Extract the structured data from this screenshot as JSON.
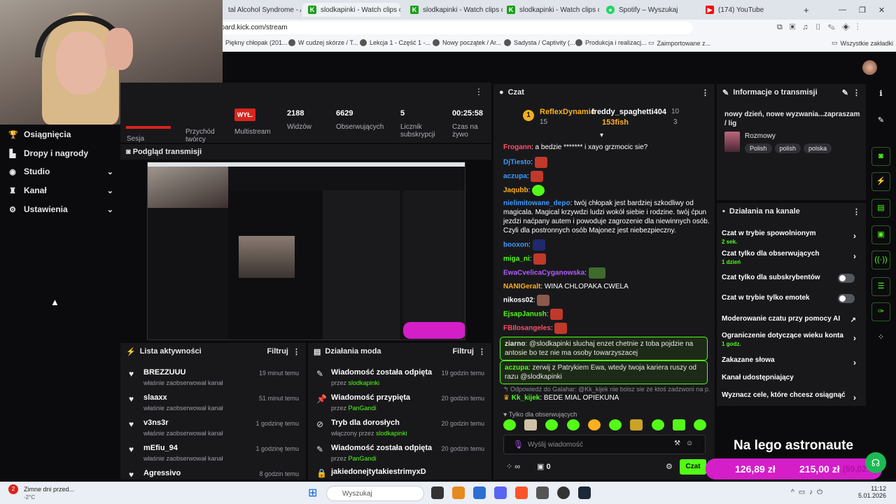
{
  "browser": {
    "tabs": [
      {
        "label": "tal Alcohol Syndrome - Albu",
        "color": "#6b6b6b",
        "glyph": ""
      },
      {
        "label": "slodkapinki - Watch clips on K",
        "color": "#1aa01a",
        "glyph": "K"
      },
      {
        "label": "slodkapinki - Watch clips on K",
        "color": "#1aa01a",
        "glyph": "K"
      },
      {
        "label": "slodkapinki - Watch clips on K",
        "color": "#1aa01a",
        "glyph": "K"
      },
      {
        "label": "Spotify – Wyszukaj",
        "color": "#1ed760",
        "glyph": "●"
      },
      {
        "label": "(174) YouTube",
        "color": "#ff0000",
        "glyph": "▶"
      }
    ],
    "new_tab": "+",
    "url": "board.kick.com/stream",
    "bookmarks": [
      "Piękny chłopak (201...",
      "W cudzej skórze / T...",
      "Lekcja 1 - Część 1 -...",
      "Nowy początek / Ar...",
      "Sadysta / Captivity (...",
      "Produkcja i realizacj...",
      "Zaimportowane z..."
    ],
    "all_bookmarks": "Wszystkie zakładki"
  },
  "nav": {
    "items": [
      {
        "label": "Osiągnięcia",
        "icon": "trophy-icon",
        "glyph": "🏆",
        "chevron": false
      },
      {
        "label": "Dropy i nagrody",
        "icon": "gift-icon",
        "glyph": "▙",
        "chevron": false
      },
      {
        "label": "Studio",
        "icon": "studio-icon",
        "glyph": "◉",
        "chevron": true
      },
      {
        "label": "Kanał",
        "icon": "channel-icon",
        "glyph": "♜",
        "chevron": true
      },
      {
        "label": "Ustawienia",
        "icon": "gear-icon",
        "glyph": "⚙",
        "chevron": true
      }
    ]
  },
  "stats": {
    "session": "Sesja",
    "income": "Przychód twórcy",
    "badge": "WYŁ.",
    "multistream": "Multistream",
    "viewers_value": "2188",
    "viewers_label": "Widzów",
    "followers_value": "6629",
    "followers_label": "Obserwujących",
    "subs_value": "5",
    "subs_label": "Licznik subskrypcji",
    "live_value": "00:25:58",
    "live_label": "Czas na żywo"
  },
  "preview": {
    "title": "Podgląd transmisji"
  },
  "activity": {
    "title": "Lista aktywności",
    "filter": "Filtruj",
    "items": [
      {
        "name": "BREZZUUU",
        "sub": "właśnie zaobserwował kanał",
        "time": "19 minut temu"
      },
      {
        "name": "slaaxx",
        "sub": "właśnie zaobserwował kanał",
        "time": "51 minut temu"
      },
      {
        "name": "v3ns3r",
        "sub": "właśnie zaobserwował kanał",
        "time": "1 godzinę temu"
      },
      {
        "name": "mEfiu_94",
        "sub": "właśnie zaobserwował kanał",
        "time": "1 godzinę temu"
      },
      {
        "name": "Agressivo",
        "sub": "",
        "time": "8 godzin temu"
      }
    ]
  },
  "modactions": {
    "title": "Działania moda",
    "filter": "Filtruj",
    "items": [
      {
        "title": "Wiadomość została odpięta",
        "by": "przez",
        "who": "slodkapinki",
        "time": "19 godzin temu",
        "icon": "pin-off-icon",
        "glyph": "✎"
      },
      {
        "title": "Wiadomość przypięta",
        "by": "przez",
        "who": "PanGandi",
        "time": "20 godzin temu",
        "icon": "pin-icon",
        "glyph": "📌"
      },
      {
        "title": "Tryb dla dorosłych",
        "by": "włączony przez",
        "who": "slodkapinki",
        "time": "20 godzin temu",
        "icon": "eye-off-icon",
        "glyph": "⊘"
      },
      {
        "title": "Wiadomość została odpięta",
        "by": "przez",
        "who": "PanGandi",
        "time": "20 godzin temu",
        "icon": "pin-off-icon",
        "glyph": "✎"
      },
      {
        "title": "jakiedonejtytakiestrimyxD",
        "by": "",
        "who": "",
        "time": "",
        "icon": "lock-icon",
        "glyph": "🔒"
      }
    ]
  },
  "chat": {
    "title": "Czat",
    "pinned": [
      {
        "name": "ReflexDynamic",
        "count": "15"
      },
      {
        "name": "freddy_spaghetti404",
        "count": "10"
      },
      {
        "name": "153fish",
        "count": "3"
      }
    ],
    "rank": "1",
    "messages": [
      {
        "user": "Frogann",
        "color": "#ff4f6a",
        "text": ": a bedzie ******* i xayo grzmocic sie?"
      },
      {
        "user": "DjTiesto",
        "color": "#3d9bff",
        "text": ":"
      },
      {
        "user": "aczupa",
        "color": "#3d9bff",
        "text": ":"
      },
      {
        "user": "Jaqubb",
        "color": "#ffb020",
        "text": ":"
      },
      {
        "user": "nielimitowane_depo",
        "color": "#3d9bff",
        "text": ": twój chłopak jest bardziej szkodliwy od magicala. Magical krzywdzi ludzi wokół siebie i rodzine. twój ćpun jezdzi naćpany autem i powoduje zagrozenie dla niewinnych osób. Czyli dla postronnych osób Majonez jest niebezpieczny."
      },
      {
        "user": "booxon",
        "color": "#3d9bff",
        "text": ":"
      },
      {
        "user": "miga_ni",
        "color": "#53fc18",
        "text": ":"
      },
      {
        "user": "EwaCvelicaCyganowska",
        "color": "#b35cff",
        "text": ":"
      },
      {
        "user": "NANIGeralt",
        "color": "#ffb020",
        "text": ": WINA CHLOPAKA CWELA"
      },
      {
        "user": "nikoss02",
        "color": "#ffffff",
        "text": ":"
      },
      {
        "user": "EjsapJanush",
        "color": "#53fc18",
        "text": ":"
      },
      {
        "user": "FBIlosangeles",
        "color": "#ff4f6a",
        "text": ":"
      }
    ],
    "highlight1_user": "ziarno",
    "highlight1_text": ": @slodkapinki sluchaj enzet chetnie z toba pojdzie na antosie bo tez nie ma osoby towarzyszacej",
    "highlight2_user": "aczupa",
    "highlight2_text": ": zerwij z Patrykiem Ewa, wtedy twoja kariera ruszy od razu @slodkapinki",
    "reply_info": "↰ Odpowiedź do Galahar: @Kk_kijek nie boisz sie że ktoś zadzwoni na p...",
    "reply_user": "Kk_kijek",
    "reply_text": ": BEDE MIAL OPIEKUNA",
    "followers_only": "Tylko dla obserwujących",
    "input_placeholder": "Wyślij wiadomość",
    "points": "0",
    "send_label": "Czat"
  },
  "info": {
    "title": "Informacje o transmisji",
    "stream_title": "nowy dzień, nowe wyzwania...zapraszam / lig",
    "category": "Rozmowy",
    "tags": [
      "Polish",
      "polish",
      "polska"
    ]
  },
  "mod": {
    "title": "Działania na kanale",
    "rows": [
      {
        "label": "Czat w trybie spowolnionym",
        "sub": "2 sek.",
        "control": "arrow"
      },
      {
        "label": "Czat tylko dla obserwujących",
        "sub": "1 dzień",
        "control": "arrow"
      },
      {
        "label": "Czat tylko dla subskrybentów",
        "sub": "",
        "control": "toggle"
      },
      {
        "label": "Czat w trybie tylko emotek",
        "sub": "",
        "control": "toggle"
      },
      {
        "label": "Moderowanie czatu przy pomocy AI",
        "sub": "",
        "control": "external"
      },
      {
        "label": "Ograniczenie dotyczące wieku konta",
        "sub": "1 godz.",
        "control": "arrow"
      },
      {
        "label": "Zakazane słowa",
        "sub": "",
        "control": "arrow"
      },
      {
        "label": "Kanał udostępniający",
        "sub": "",
        "control": "none"
      },
      {
        "label": "Wyznacz cele, które chcesz osiągnąć",
        "sub": "",
        "control": "arrow"
      }
    ]
  },
  "overlay": {
    "title": "Na lego astronaute",
    "amount1": "126,89 zł",
    "amount2": "215,00 zł",
    "percent": "(59,02%)"
  },
  "taskbar": {
    "weather_title": "Zimne dni przed...",
    "weather_temp": "-2°C",
    "weather_badge": "2",
    "search": "Wyszukaj",
    "time": "11:12",
    "date": "5.01.2026"
  },
  "colors": {
    "accent": "#53fc18",
    "live": "#d8241d",
    "overlay": "#d41ec8"
  }
}
